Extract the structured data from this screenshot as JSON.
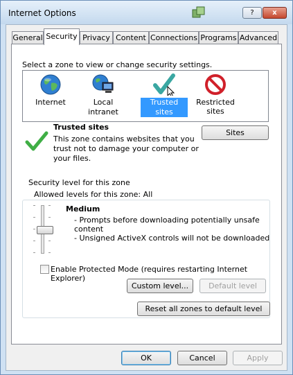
{
  "window": {
    "title": "Internet Options",
    "help_label": "?",
    "close_label": "x"
  },
  "tabs": [
    {
      "label": "General"
    },
    {
      "label": "Security"
    },
    {
      "label": "Privacy"
    },
    {
      "label": "Content"
    },
    {
      "label": "Connections"
    },
    {
      "label": "Programs"
    },
    {
      "label": "Advanced"
    }
  ],
  "security": {
    "zone_prompt": "Select a zone to view or change security settings.",
    "zones": [
      {
        "label": "Internet",
        "icon": "globe-icon"
      },
      {
        "label": "Local intranet",
        "icon": "intranet-icon"
      },
      {
        "label": "Trusted sites",
        "icon": "checkmark-icon"
      },
      {
        "label_line1": "Restricted",
        "label_line2": "sites",
        "icon": "restricted-icon"
      }
    ],
    "selected_zone": "Trusted sites",
    "zone_info": {
      "title": "Trusted sites",
      "line1": "This zone contains websites that you",
      "line2": "trust not to damage your computer or",
      "line3": "your files."
    },
    "sites_button": "Sites",
    "level_group": {
      "title": "Security level for this zone",
      "allowed": "Allowed levels for this zone: All",
      "level_name": "Medium",
      "bullet1_line1": "- Prompts before downloading potentially unsafe",
      "bullet1_line2": "content",
      "bullet2": "- Unsigned ActiveX controls will not be downloaded",
      "slider_level": "Medium"
    },
    "protected_mode": {
      "label": "Enable Protected Mode (requires restarting Internet Explorer)",
      "checked": false
    },
    "custom_level_button": "Custom level...",
    "default_level_button": "Default level",
    "reset_button": "Reset all zones to default level"
  },
  "footer": {
    "ok": "OK",
    "cancel": "Cancel",
    "apply": "Apply"
  },
  "colors": {
    "selection": "#3399ff",
    "check_green": "#3fae45",
    "restricted_red": "#d0202a"
  }
}
